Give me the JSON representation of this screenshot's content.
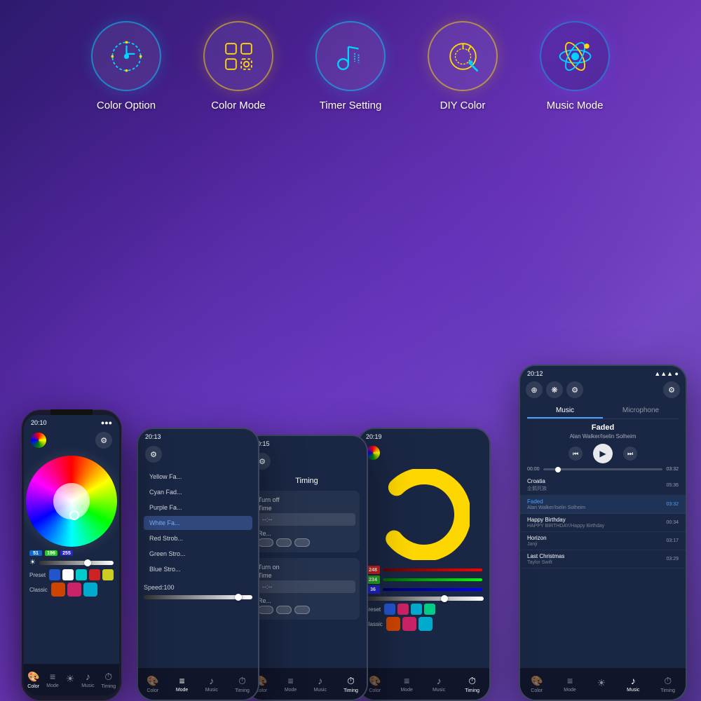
{
  "background": {
    "gradient": "linear-gradient(135deg, #2d1b6e 0%, #4a2090 25%, #6b35b8 50%, #7b4bc8 70%, #5a3aa0 100%)"
  },
  "icons": [
    {
      "id": "color-option",
      "label": "Color Option",
      "color": "#00d4ff"
    },
    {
      "id": "color-mode",
      "label": "Color Mode",
      "color": "#ffdd00"
    },
    {
      "id": "timer-setting",
      "label": "Timer Setting",
      "color": "#00d4ff"
    },
    {
      "id": "diy-color",
      "label": "DIY Color",
      "color": "#ffdd00"
    },
    {
      "id": "music-mode",
      "label": "Music Mode",
      "color": "#00d4ff"
    }
  ],
  "phones": {
    "phone1": {
      "time": "20:10",
      "screen": "color-option",
      "rgb": {
        "r": "51",
        "g": "196",
        "b": "255"
      },
      "presetColors": [
        "#2255cc",
        "#ffffff",
        "#00cccc",
        "#cc2222",
        "#cccc00"
      ],
      "classicColors": [
        "#cc4400",
        "#cc2266",
        "#00aacc"
      ]
    },
    "phone2": {
      "time": "20:13",
      "screen": "color-mode",
      "modes": [
        "Yellow Fa...",
        "Cyan Fad...",
        "Purple Fa...",
        "White Fa...",
        "Red Strob...",
        "Green Stro...",
        "Blue Stro..."
      ],
      "activeMode": "White Fa...",
      "speed": "Speed:100"
    },
    "phone3": {
      "time": "20:15",
      "screen": "timer",
      "title": "Timing",
      "turnOff": "Turn off",
      "time_label": "Time",
      "repeat_label": "Re...",
      "turnOn": "Turn on"
    },
    "phone4": {
      "time": "20:19",
      "screen": "diy-color",
      "rgb_values": {
        "r": "248",
        "g": "234",
        "b": "36"
      },
      "presetColors": [
        "#2255cc",
        "#cc2266",
        "#00aacc",
        "#00cc88"
      ],
      "classicColors": [
        "#cc4400",
        "#cc2266",
        "#00aacc"
      ]
    },
    "phone5": {
      "time": "20:12",
      "screen": "music",
      "tabs": [
        "Music",
        "Microphone"
      ],
      "activeTab": "Music",
      "song": {
        "title": "Faded",
        "artist": "Alan Walker/Iselin Solheim"
      },
      "progress": {
        "current": "00:00",
        "total": "03:32"
      },
      "playlist": [
        {
          "name": "Croatia",
          "sub": "企鹅死族",
          "duration": "05:36",
          "active": false
        },
        {
          "name": "Faded",
          "sub": "Alan Walker/Iselin Solheim",
          "duration": "03:32",
          "active": true
        },
        {
          "name": "Happy Birthday",
          "sub": "HAPPY BIRTHDAY/Happy Birthday",
          "duration": "00:34",
          "active": false
        },
        {
          "name": "Horizon",
          "sub": "Janji",
          "duration": "03:17",
          "active": false
        },
        {
          "name": "Last Christmas",
          "sub": "Taylor Swift",
          "duration": "03:29",
          "active": false
        }
      ]
    }
  },
  "nav": {
    "items": [
      "Color",
      "Mode",
      "☀",
      "Music",
      "Timing"
    ]
  }
}
